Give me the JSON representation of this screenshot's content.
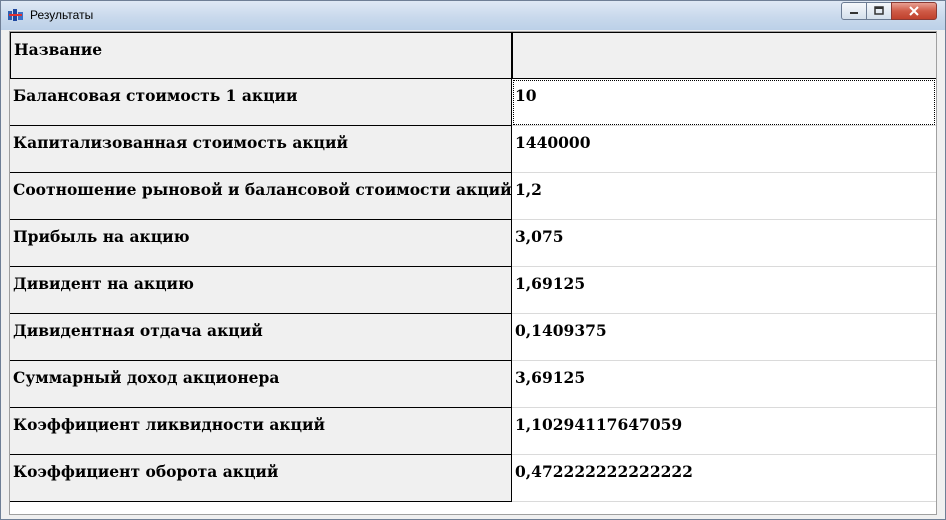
{
  "window": {
    "title": "Результаты"
  },
  "table": {
    "header": {
      "name": "Название",
      "value": ""
    },
    "rows": [
      {
        "name": "Балансовая стоимость 1 акции",
        "value": "10"
      },
      {
        "name": "Капитализованная стоимость акций",
        "value": "1440000"
      },
      {
        "name": "Соотношение рыновой и балансовой стоимости акций",
        "value": "1,2"
      },
      {
        "name": "Прибыль на акцию",
        "value": "3,075"
      },
      {
        "name": "Дивидент на акцию",
        "value": "1,69125"
      },
      {
        "name": "Дивидентная отдача акций",
        "value": "0,1409375"
      },
      {
        "name": "Суммарный доход акционера",
        "value": "3,69125"
      },
      {
        "name": "Коэффициент ликвидности акций",
        "value": "1,10294117647059"
      },
      {
        "name": "Коэффициент оборота акций",
        "value": "0,472222222222222"
      }
    ]
  },
  "colors": {
    "titlebar": "#c9d9ec",
    "close": "#c0412d",
    "fixed_cell": "#f0f0f0"
  }
}
